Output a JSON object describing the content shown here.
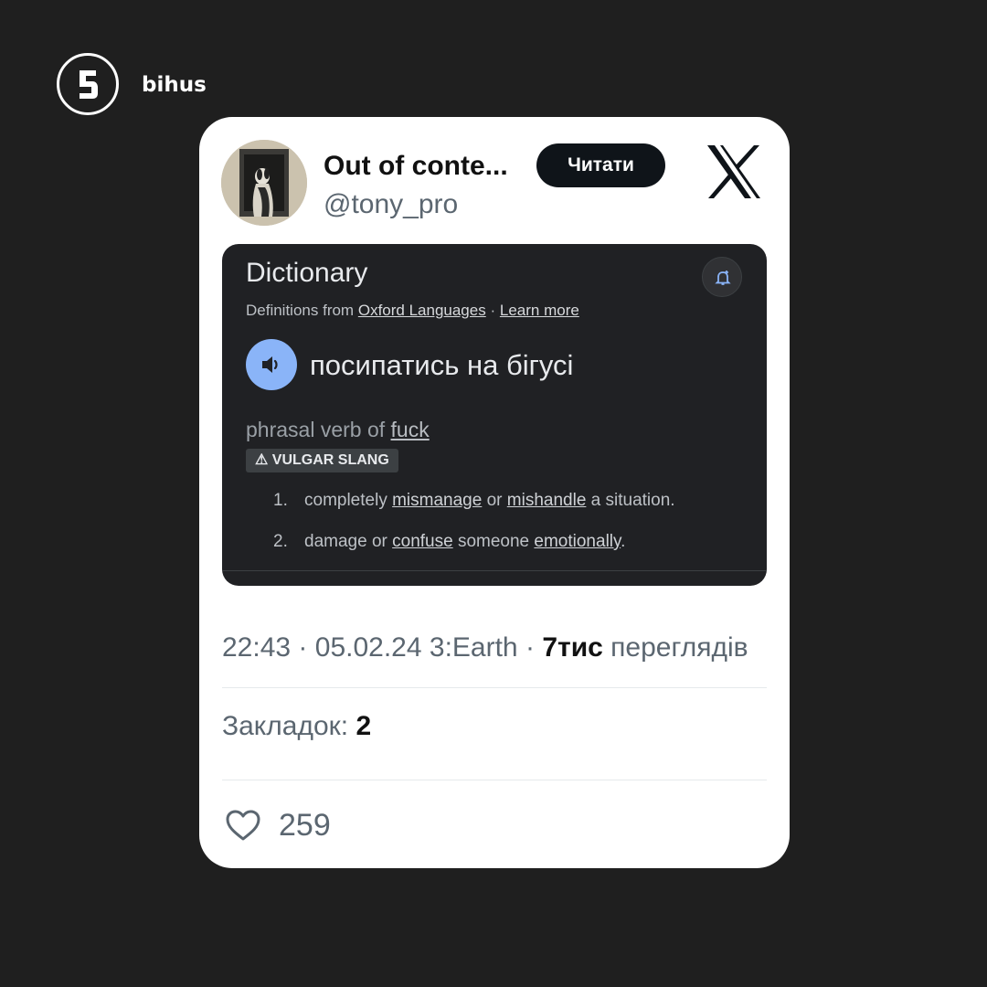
{
  "brand": {
    "name": "bihus",
    "logo_icon": "bihus-b-logo-icon"
  },
  "tweet": {
    "display_name": "Out of conte...",
    "handle": "@tony_pro",
    "follow_label": "Читати",
    "platform_icon": "x-logo-icon",
    "avatar_icon": "dog-portrait-avatar",
    "time": "22:43",
    "date": "05.02.24",
    "source": "3:Earth",
    "separator": "·",
    "views_count": "7тис",
    "views_label": "переглядів",
    "bookmarks_label": "Закладок:",
    "bookmarks_count": "2",
    "likes_count": "259",
    "like_icon": "heart-icon"
  },
  "dictionary": {
    "title": "Dictionary",
    "source_prefix": "Definitions from",
    "source_link": "Oxford Languages",
    "source_sep": "·",
    "learn_more": "Learn more",
    "bell_icon": "notification-bell-icon",
    "speaker_icon": "speaker-icon",
    "headword": "посипатись на бігусі",
    "pos_prefix": "phrasal verb of",
    "pos_link": "fuck",
    "register_icon": "warning-icon",
    "register_label": "VULGAR SLANG",
    "definitions": [
      {
        "num": "1.",
        "parts": [
          {
            "text": "completely ",
            "link": false
          },
          {
            "text": "mismanage",
            "link": true
          },
          {
            "text": " or ",
            "link": false
          },
          {
            "text": "mishandle",
            "link": true
          },
          {
            "text": " a situation.",
            "link": false
          }
        ]
      },
      {
        "num": "2.",
        "parts": [
          {
            "text": "damage or ",
            "link": false
          },
          {
            "text": "confuse",
            "link": true
          },
          {
            "text": " someone ",
            "link": false
          },
          {
            "text": "emotionally",
            "link": true
          },
          {
            "text": ".",
            "link": false
          }
        ]
      }
    ]
  },
  "colors": {
    "page_background": "#1f1f1f",
    "card_background": "#ffffff",
    "dictionary_background": "#202124",
    "speaker_accent": "#8ab4f8",
    "follow_button": "#0f1419"
  }
}
